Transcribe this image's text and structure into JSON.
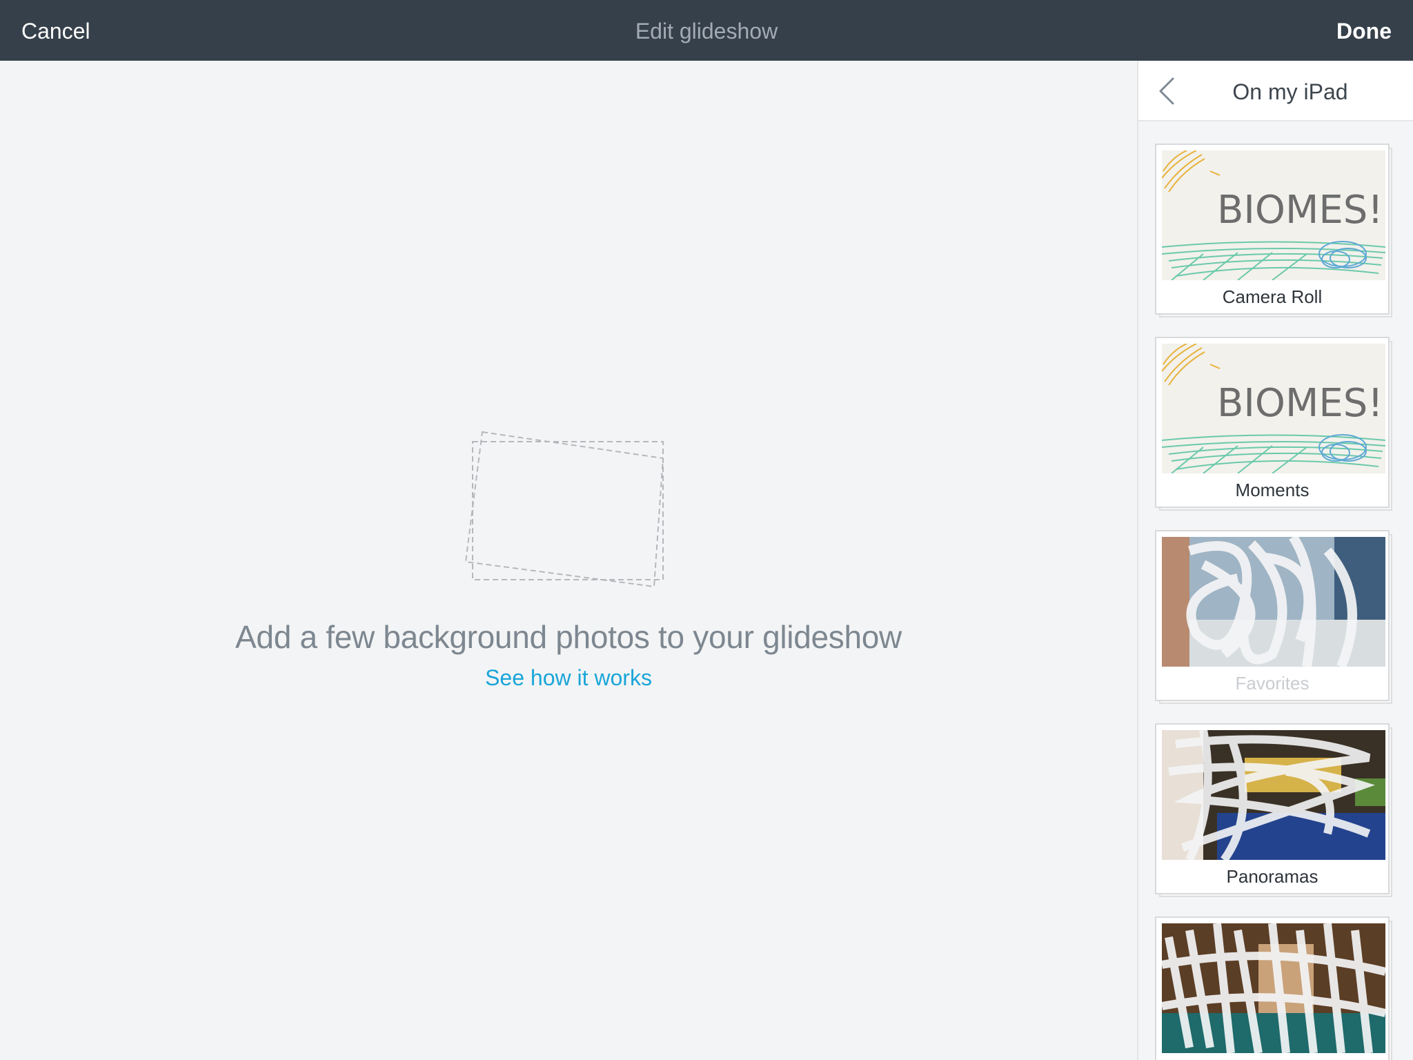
{
  "topbar": {
    "cancel_label": "Cancel",
    "title": "Edit glideshow",
    "done_label": "Done"
  },
  "main": {
    "empty_title": "Add a few background photos to your glideshow",
    "link_label": "See how it works"
  },
  "sidebar": {
    "title": "On my iPad",
    "albums": [
      {
        "label": "Camera Roll",
        "thumbnail_text": "BIOMES!"
      },
      {
        "label": "Moments",
        "thumbnail_text": "BIOMES!"
      },
      {
        "label": "Favorites"
      },
      {
        "label": "Panoramas"
      },
      {
        "label": ""
      }
    ]
  },
  "colors": {
    "topbar_bg": "#36404a",
    "background": "#f3f4f5",
    "link": "#1aa5d8",
    "muted_text": "#7d8790"
  }
}
